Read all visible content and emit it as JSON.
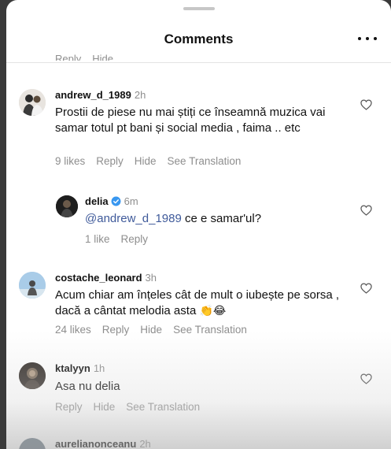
{
  "header": {
    "title": "Comments",
    "more_icon": "more-horizontal-icon"
  },
  "clipped_previous": {
    "reply": "Reply",
    "hide": "Hide"
  },
  "comments": [
    {
      "username": "andrew_d_1989",
      "time": "2h",
      "text": "Prostii de piese nu mai știți ce înseamnă muzica vai samar totul pt bani și social media , faima .. etc",
      "likes": "9 likes",
      "reply": "Reply",
      "hide": "Hide",
      "translate": "See Translation"
    },
    {
      "username": "delia",
      "verified": true,
      "time": "6m",
      "mention": "@andrew_d_1989",
      "text": " ce e samar'ul?",
      "likes": "1 like",
      "reply": "Reply"
    },
    {
      "username": "costache_leonard",
      "time": "3h",
      "text": "Acum chiar am înțeles cât de mult o iubește pe sorsa , dacă a cântat melodia asta",
      "emoji": "👏😂",
      "likes": "24 likes",
      "reply": "Reply",
      "hide": "Hide",
      "translate": "See Translation"
    },
    {
      "username": "ktalyyn",
      "time": "1h",
      "text": "Asa nu delia",
      "reply": "Reply",
      "hide": "Hide",
      "translate": "See Translation"
    },
    {
      "username": "aurelianonceanu",
      "time": "2h"
    }
  ],
  "colors": {
    "accent_blue": "#3897f0",
    "mention": "#3f5a9a",
    "muted": "#8e8e8e"
  }
}
